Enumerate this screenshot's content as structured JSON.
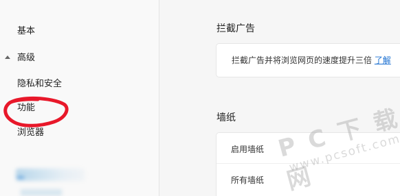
{
  "sidebar": {
    "items": [
      {
        "label": "基本"
      },
      {
        "label": "高级"
      },
      {
        "label": "隐私和安全"
      },
      {
        "label": "功能"
      },
      {
        "label": "浏览器"
      }
    ]
  },
  "main": {
    "adblock": {
      "title": "拦截广告",
      "description": "拦截广告并将浏览网页的速度提升三倍",
      "link_label": "了解"
    },
    "wallpaper": {
      "title": "墙纸",
      "enable_label": "启用墙纸",
      "all_label": "所有墙纸"
    }
  },
  "watermark": {
    "big": "P C 下 载 网",
    "small": "www.pcsoft.com.cn"
  },
  "colors": {
    "link": "#1a6fd1",
    "annotation": "#e8182a"
  }
}
